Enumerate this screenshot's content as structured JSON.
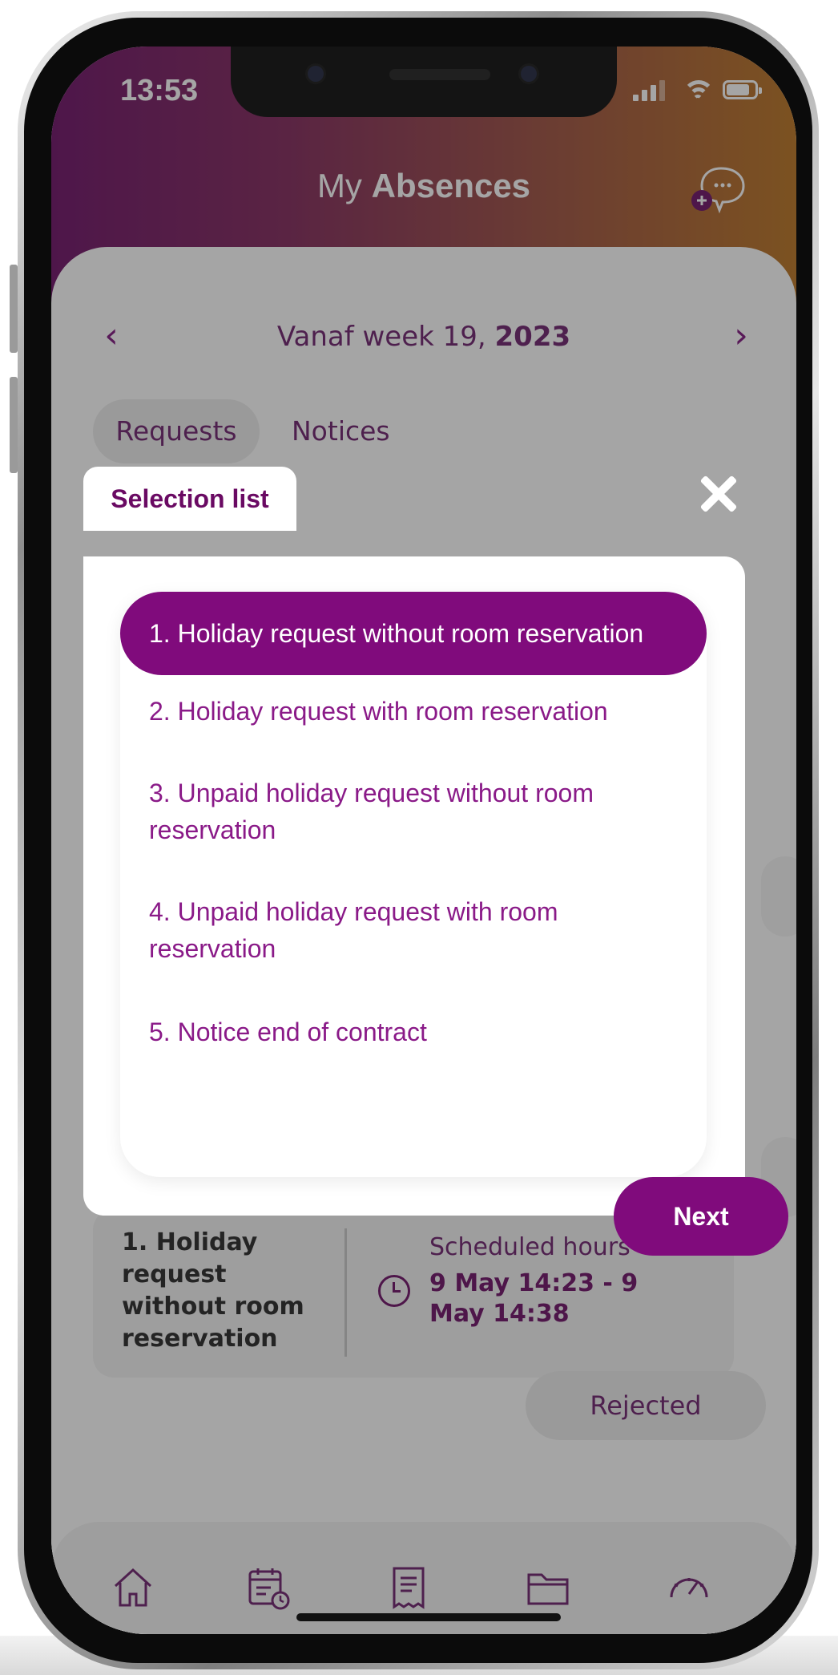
{
  "status_bar": {
    "time": "13:53"
  },
  "header": {
    "title_light": "My",
    "title_bold": "Absences"
  },
  "week_selector": {
    "prefix": "Vanaf week 19,",
    "year": "2023"
  },
  "tabs": [
    {
      "label": "Requests"
    },
    {
      "label": "Notices"
    }
  ],
  "modal": {
    "tab_label": "Selection list",
    "options": [
      {
        "label": "1. Holiday request without room reservation"
      },
      {
        "label": "2. Holiday request with room reservation"
      },
      {
        "label": "3. Unpaid holiday request without room reservation"
      },
      {
        "label": "4. Unpaid holiday request with room reservation"
      },
      {
        "label": "5. Notice end of contract"
      }
    ],
    "selected_index": 0,
    "next_label": "Next"
  },
  "request_card": {
    "title": "1. Holiday request without room reservation",
    "scheduled_label": "Scheduled hours",
    "scheduled_value": "9 May 14:23 - 9 May 14:38",
    "status": "Rejected"
  },
  "bottom_nav": [
    {
      "icon": "home-icon"
    },
    {
      "icon": "calendar-clock-icon"
    },
    {
      "icon": "receipt-icon"
    },
    {
      "icon": "folder-icon"
    },
    {
      "icon": "speedometer-icon"
    }
  ],
  "colors": {
    "accent": "#800b7c",
    "header_start": "#6a0a63",
    "header_end": "#b8701c"
  }
}
